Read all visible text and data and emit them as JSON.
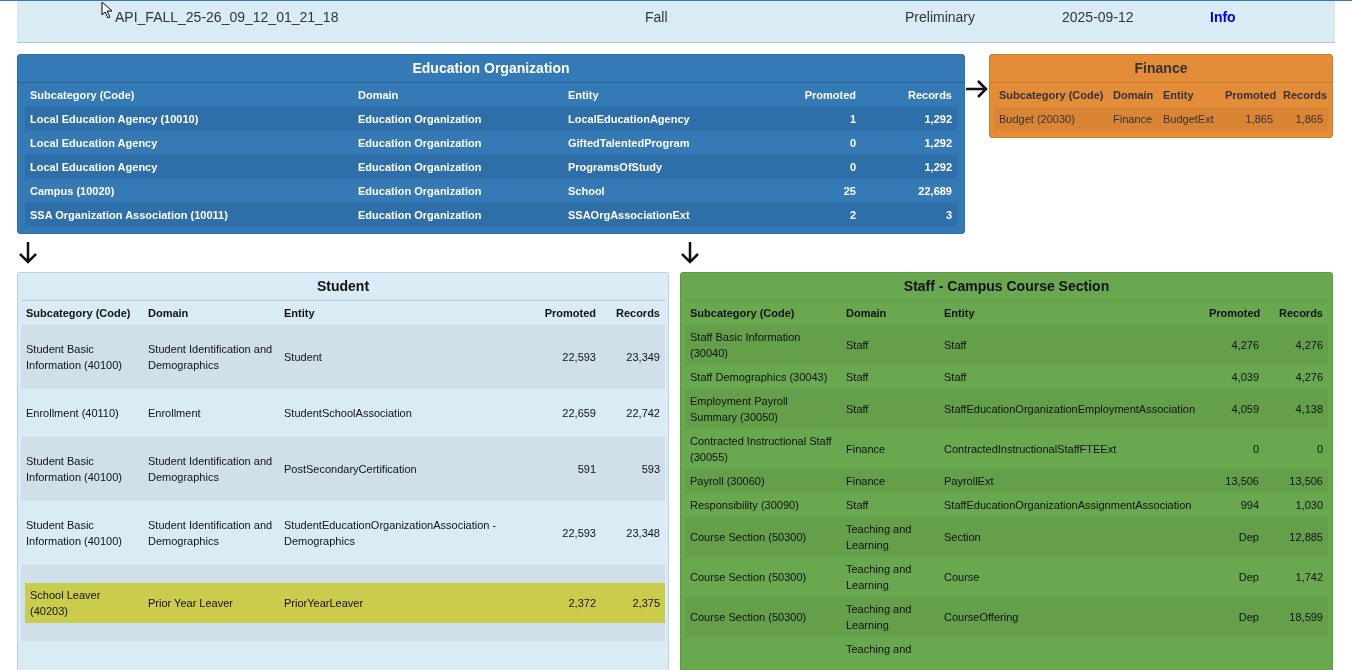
{
  "top_row": {
    "cells": [
      "API_FALL_25-26_09_12_01_21_18",
      "Fall",
      "Preliminary",
      "2025-09-12"
    ],
    "link": "Info"
  },
  "education_organization": {
    "title": "Education Organization",
    "columns": [
      "Subcategory (Code)",
      "Domain",
      "Entity",
      "Promoted",
      "Records"
    ],
    "rows": [
      {
        "cells": [
          "Local Education Agency (10010)",
          "Education Organization",
          "LocalEducationAgency",
          "1",
          "1,292"
        ]
      },
      {
        "cells": [
          "Local Education Agency",
          "Education Organization",
          "GiftedTalentedProgram",
          "0",
          "1,292"
        ]
      },
      {
        "cells": [
          "Local Education Agency",
          "Education Organization",
          "ProgramsOfStudy",
          "0",
          "1,292"
        ]
      },
      {
        "cells": [
          "Campus (10020)",
          "Education Organization",
          "School",
          "25",
          "22,689"
        ]
      },
      {
        "cells": [
          "SSA Organization Association (10011)",
          "Education Organization",
          "SSAOrgAssociationExt",
          "2",
          "3"
        ]
      }
    ]
  },
  "finance": {
    "title": "Finance",
    "columns": [
      "Subcategory (Code)",
      "Domain",
      "Entity",
      "Promoted",
      "Records"
    ],
    "rows": [
      {
        "cells": [
          "Budget (20030)",
          "Finance",
          "BudgetExt",
          "1,865",
          "1,865"
        ]
      }
    ]
  },
  "student": {
    "title": "Student",
    "columns": [
      "Subcategory (Code)",
      "Domain",
      "Entity",
      "Promoted",
      "Records"
    ],
    "rows": [
      {
        "cells": [
          "Student Basic Information (40100)",
          "Student Identification and Demographics",
          "Student",
          "22,593",
          "23,349"
        ],
        "highlighted": false
      },
      {
        "cells": [
          "Enrollment (40110)",
          "Enrollment",
          "StudentSchoolAssociation",
          "22,659",
          "22,742"
        ],
        "highlighted": false
      },
      {
        "cells": [
          "Student Basic Information (40100)",
          "Student Identification and Demographics",
          "PostSecondaryCertification",
          "591",
          "593"
        ],
        "highlighted": false
      },
      {
        "cells": [
          "Student Basic Information (40100)",
          "Student Identification and Demographics",
          "StudentEducationOrganizationAssociation - Demographics",
          "22,593",
          "23,348"
        ],
        "highlighted": false
      },
      {
        "cells": [
          "School Leaver (40203)",
          "Prior Year Leaver",
          "PriorYearLeaver",
          "2,372",
          "2,375"
        ],
        "highlighted": true
      }
    ]
  },
  "staff_campus_course_section": {
    "title": "Staff - Campus Course Section",
    "columns": [
      "Subcategory (Code)",
      "Domain",
      "Entity",
      "Promoted",
      "Records"
    ],
    "rows": [
      {
        "cells": [
          "Staff Basic Information (30040)",
          "Staff",
          "Staff",
          "4,276",
          "4,276"
        ]
      },
      {
        "cells": [
          "Staff Demographics (30043)",
          "Staff",
          "Staff",
          "4,039",
          "4,276"
        ]
      },
      {
        "cells": [
          "Employment Payroll Summary (30050)",
          "Staff",
          "StaffEducationOrganizationEmploymentAssociation",
          "4,059",
          "4,138"
        ]
      },
      {
        "cells": [
          "Contracted Instructional Staff (30055)",
          "Finance",
          "ContractedInstructionalStaffFTEExt",
          "0",
          "0"
        ]
      },
      {
        "cells": [
          "Payroll (30060)",
          "Finance",
          "PayrollExt",
          "13,506",
          "13,506"
        ]
      },
      {
        "cells": [
          "Responsibility (30090)",
          "Staff",
          "StaffEducationOrganizationAssignmentAssociation",
          "994",
          "1,030"
        ]
      },
      {
        "cells": [
          "Course Section (50300)",
          "Teaching and Learning",
          "Section",
          "Dep",
          "12,885"
        ]
      },
      {
        "cells": [
          "Course Section (50300)",
          "Teaching and Learning",
          "Course",
          "Dep",
          "1,742"
        ]
      },
      {
        "cells": [
          "Course Section (50300)",
          "Teaching and Learning",
          "CourseOffering",
          "Dep",
          "18,599"
        ]
      }
    ],
    "partial_row": {
      "domain": "Teaching and"
    }
  }
}
